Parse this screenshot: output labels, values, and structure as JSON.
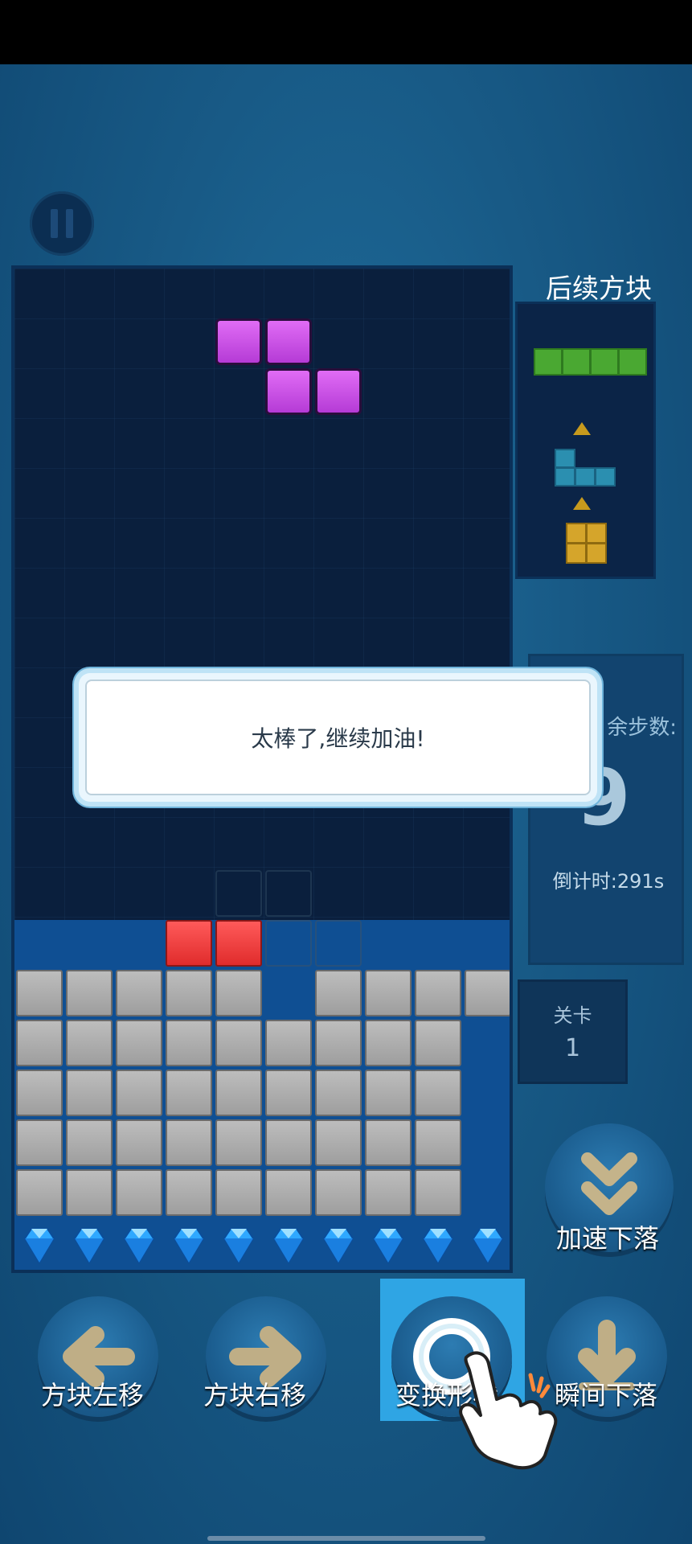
{
  "hud": {
    "pause_icon": "pause-icon"
  },
  "next_blocks": {
    "title": "后续方块",
    "pieces": [
      "I-green",
      "L-blue",
      "O-yellow"
    ]
  },
  "stats": {
    "steps_label": "余步数:",
    "steps_value": "9",
    "countdown": "倒计时:291s"
  },
  "level": {
    "label": "关卡",
    "value": "1"
  },
  "dialog": {
    "message": "太棒了,继续加油!"
  },
  "controls": {
    "left": "方块左移",
    "right": "方块右移",
    "rotate": "变换形状",
    "drop": "瞬间下落",
    "speed": "加速下落"
  },
  "colors": {
    "active_piece": "#c44ee6",
    "red_blocks": "#f23f3f",
    "filled": "#aaaaaa",
    "next_green": "#4aa832",
    "next_blue": "#2b8fb0",
    "next_yellow": "#d5a52b"
  }
}
